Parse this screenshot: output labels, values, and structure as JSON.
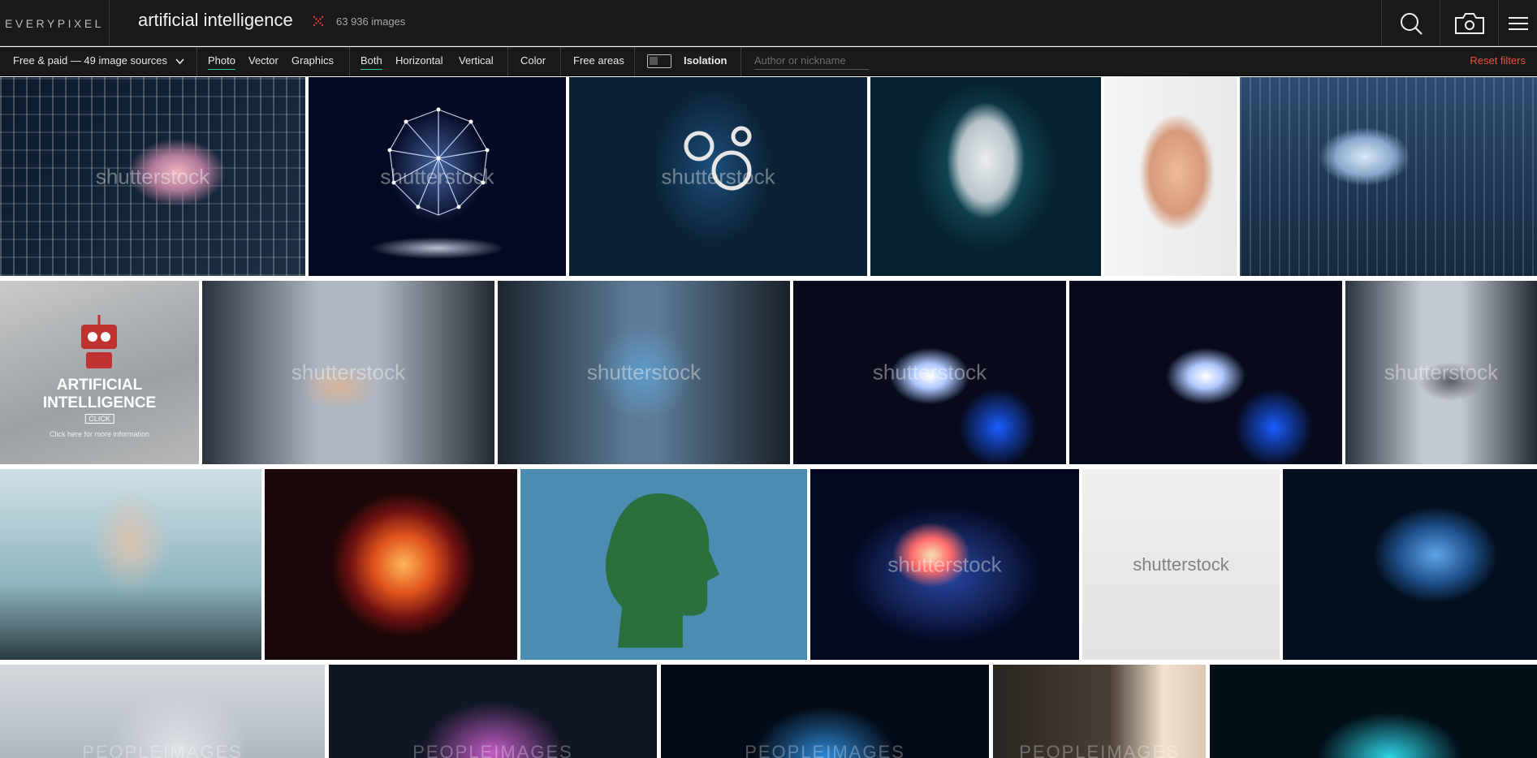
{
  "header": {
    "logo": "EVERYPIXEL",
    "search_query": "artificial intelligence",
    "results_count": "63 936 images",
    "search_button_icon": "search-icon",
    "camera_button_icon": "camera-icon",
    "menu_button_icon": "menu-icon"
  },
  "filters": {
    "sources_dropdown": "Free & paid — 49 image sources",
    "type": {
      "photo": "Photo",
      "vector": "Vector",
      "graphics": "Graphics",
      "selected": "Photo"
    },
    "orientation": {
      "both": "Both",
      "horizontal": "Horizontal",
      "vertical": "Vertical",
      "selected": "Both"
    },
    "color": "Color",
    "free_areas": "Free areas",
    "isolation": "Isolation",
    "isolation_enabled": false,
    "author_placeholder": "Author or nickname",
    "author_value": "",
    "reset": "Reset filters"
  },
  "colors": {
    "header_bg": "#191919",
    "accent": "#2ec4a0",
    "reset": "#e8533f"
  },
  "results": [
    {
      "watermark": "shutterstock",
      "subject": "brain-on-circuit-board"
    },
    {
      "watermark": "shutterstock",
      "subject": "wireframe-brain-hologram"
    },
    {
      "watermark": "shutterstock",
      "subject": "head-with-gears"
    },
    {
      "watermark": "",
      "subject": "android-face"
    },
    {
      "watermark": "",
      "subject": "mannequin-head-circuit"
    },
    {
      "watermark": "",
      "subject": "brain-in-cyberspace"
    },
    {
      "watermark": "",
      "subject": "ai-promo-robot",
      "title": "ARTIFICIAL INTELLIGENCE",
      "button": "CLICK",
      "caption": "Click here for more information"
    },
    {
      "watermark": "shutterstock",
      "subject": "robot-handshake"
    },
    {
      "watermark": "shutterstock",
      "subject": "robot-handshake-hologram"
    },
    {
      "watermark": "shutterstock",
      "subject": "digital-hand-touch"
    },
    {
      "watermark": "",
      "subject": "digital-hand-touch-2"
    },
    {
      "watermark": "shutterstock",
      "subject": "robot-handshake-2"
    },
    {
      "watermark": "",
      "subject": "businessman-matrix"
    },
    {
      "watermark": "",
      "subject": "colorful-profile"
    },
    {
      "watermark": "",
      "subject": "circuit-head-silhouette"
    },
    {
      "watermark": "shutterstock",
      "subject": "abstract-mind"
    },
    {
      "watermark": "shutterstock",
      "subject": "puzzle-robot"
    },
    {
      "watermark": "",
      "subject": "network-profile"
    },
    {
      "watermark": "PEOPLEIMAGES",
      "subject": "robot-head-closeup"
    },
    {
      "watermark": "PEOPLEIMAGES",
      "subject": "pink-brain"
    },
    {
      "watermark": "PEOPLEIMAGES",
      "subject": "blue-brain"
    },
    {
      "watermark": "PEOPLEIMAGES",
      "subject": "robot-library"
    },
    {
      "watermark": "",
      "subject": "cyan-brain"
    }
  ]
}
